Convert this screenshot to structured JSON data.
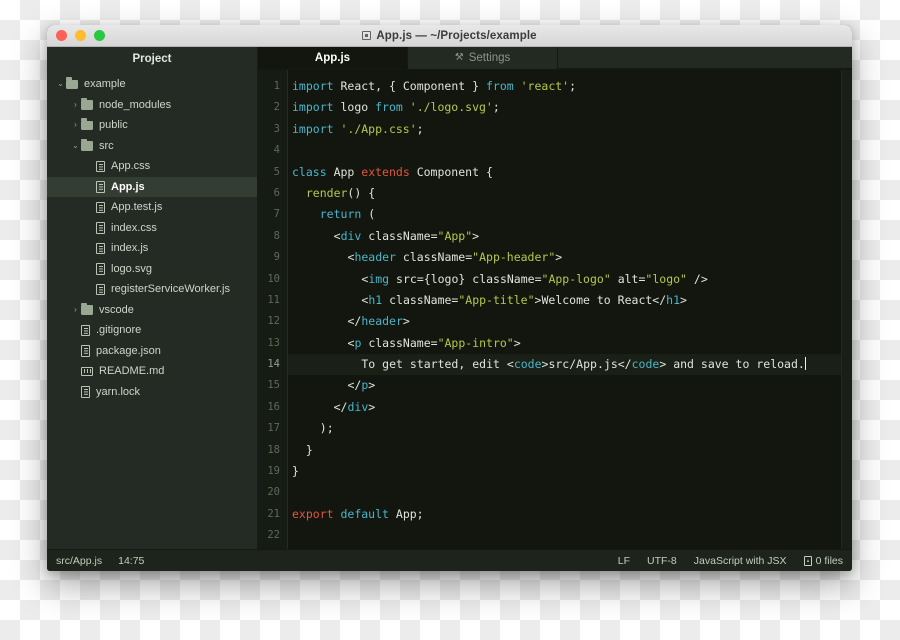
{
  "window": {
    "title": "App.js — ~/Projects/example",
    "title_icon": "app-window-icon",
    "traffic_lights": {
      "close": "close-button",
      "minimize": "minimize-button",
      "zoom": "zoom-button"
    }
  },
  "sidebar": {
    "header": "Project",
    "tree": [
      {
        "label": "example",
        "depth": 0,
        "type": "folder",
        "chevron": "⌄",
        "selected": false
      },
      {
        "label": "node_modules",
        "depth": 1,
        "type": "folder",
        "chevron": "›",
        "selected": false
      },
      {
        "label": "public",
        "depth": 1,
        "type": "folder",
        "chevron": "›",
        "selected": false
      },
      {
        "label": "src",
        "depth": 1,
        "type": "folder",
        "chevron": "⌄",
        "selected": false
      },
      {
        "label": "App.css",
        "depth": 2,
        "type": "file",
        "chevron": "",
        "selected": false
      },
      {
        "label": "App.js",
        "depth": 2,
        "type": "file",
        "chevron": "",
        "selected": true
      },
      {
        "label": "App.test.js",
        "depth": 2,
        "type": "file",
        "chevron": "",
        "selected": false
      },
      {
        "label": "index.css",
        "depth": 2,
        "type": "file",
        "chevron": "",
        "selected": false
      },
      {
        "label": "index.js",
        "depth": 2,
        "type": "file",
        "chevron": "",
        "selected": false
      },
      {
        "label": "logo.svg",
        "depth": 2,
        "type": "file",
        "chevron": "",
        "selected": false
      },
      {
        "label": "registerServiceWorker.js",
        "depth": 2,
        "type": "file",
        "chevron": "",
        "selected": false
      },
      {
        "label": "vscode",
        "depth": 1,
        "type": "folder",
        "chevron": "›",
        "selected": false
      },
      {
        "label": ".gitignore",
        "depth": 1,
        "type": "file",
        "chevron": "",
        "selected": false
      },
      {
        "label": "package.json",
        "depth": 1,
        "type": "file",
        "chevron": "",
        "selected": false
      },
      {
        "label": "README.md",
        "depth": 1,
        "type": "md",
        "chevron": "",
        "selected": false
      },
      {
        "label": "yarn.lock",
        "depth": 1,
        "type": "file",
        "chevron": "",
        "selected": false
      }
    ]
  },
  "tabs": [
    {
      "label": "App.js",
      "active": true,
      "icon": ""
    },
    {
      "label": "Settings",
      "active": false,
      "icon": "⚒"
    }
  ],
  "editor": {
    "current_line": 14,
    "line_numbers": [
      "1",
      "2",
      "3",
      "4",
      "5",
      "6",
      "7",
      "8",
      "9",
      "10",
      "11",
      "12",
      "13",
      "14",
      "15",
      "16",
      "17",
      "18",
      "19",
      "20",
      "21",
      "22"
    ],
    "lines": [
      "import React, { Component } from 'react';",
      "import logo from './logo.svg';",
      "import './App.css';",
      "",
      "class App extends Component {",
      "  render() {",
      "    return (",
      "      <div className=\"App\">",
      "        <header className=\"App-header\">",
      "          <img src={logo} className=\"App-logo\" alt=\"logo\" />",
      "          <h1 className=\"App-title\">Welcome to React</h1>",
      "        </header>",
      "        <p className=\"App-intro\">",
      "          To get started, edit <code>src/App.js</code> and save to reload.",
      "        </p>",
      "      </div>",
      "    );",
      "  }",
      "}",
      "",
      "export default App;",
      ""
    ]
  },
  "statusbar": {
    "file_path": "src/App.js",
    "cursor_position": "14:75",
    "line_ending": "LF",
    "encoding": "UTF-8",
    "language": "JavaScript with JSX",
    "files_count": "0 files",
    "files_icon": "file-upload-icon"
  },
  "colors": {
    "window_chrome": "#dcdcdc",
    "sidebar_bg": "#242b24",
    "editor_bg": "#12160f",
    "tab_active_bg": "#12160f",
    "tab_inactive_bg": "#232a22",
    "statusbar_bg": "#1e241c",
    "keyword_cyan": "#49b5c9",
    "keyword_red": "#e2553c",
    "string_green": "#b5c948",
    "plain_text": "#dfe4da",
    "selection_green": "#333d31"
  }
}
